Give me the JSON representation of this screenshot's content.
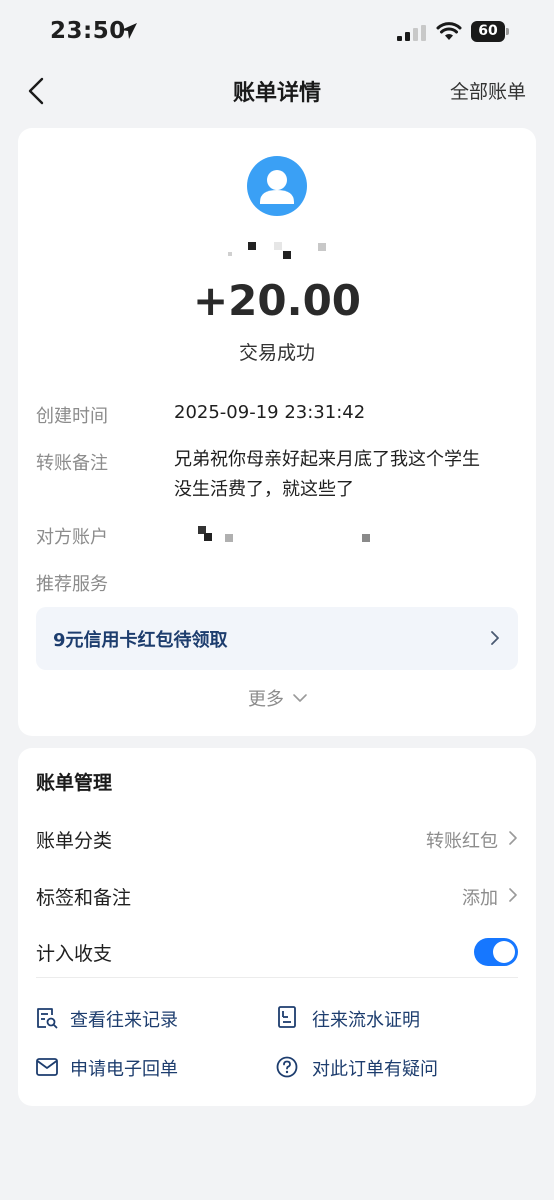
{
  "status": {
    "time": "23:50",
    "battery": "60"
  },
  "nav": {
    "title": "账单详情",
    "right_link": "全部账单"
  },
  "transaction": {
    "amount": "+20.00",
    "status": "交易成功",
    "rows": {
      "created_label": "创建时间",
      "created_value": "2025-09-19 23:31:42",
      "note_label": "转账备注",
      "note_line1": "兄弟祝你母亲好起来月底了我这个学生",
      "note_line2": "没生活费了，就这些了",
      "account_label": "对方账户",
      "service_label": "推荐服务"
    },
    "promo": "9元信用卡红包待领取",
    "more": "更多"
  },
  "manage": {
    "title": "账单管理",
    "category_label": "账单分类",
    "category_value": "转账红包",
    "tag_label": "标签和备注",
    "tag_value": "添加",
    "include_label": "计入收支",
    "include_on": true,
    "links": {
      "records": "查看往来记录",
      "flow_proof": "往来流水证明",
      "receipt": "申请电子回单",
      "question": "对此订单有疑问"
    }
  },
  "colors": {
    "accent": "#1677ff",
    "link": "#1d3d6e",
    "avatar": "#3aa0f5",
    "background": "#f2f3f5"
  },
  "icons": [
    "location-arrow-icon",
    "signal-icon",
    "wifi-icon",
    "back-icon",
    "user-icon",
    "chevron-right-icon",
    "chevron-down-icon",
    "record-search-icon",
    "document-icon",
    "mail-icon",
    "question-icon"
  ]
}
